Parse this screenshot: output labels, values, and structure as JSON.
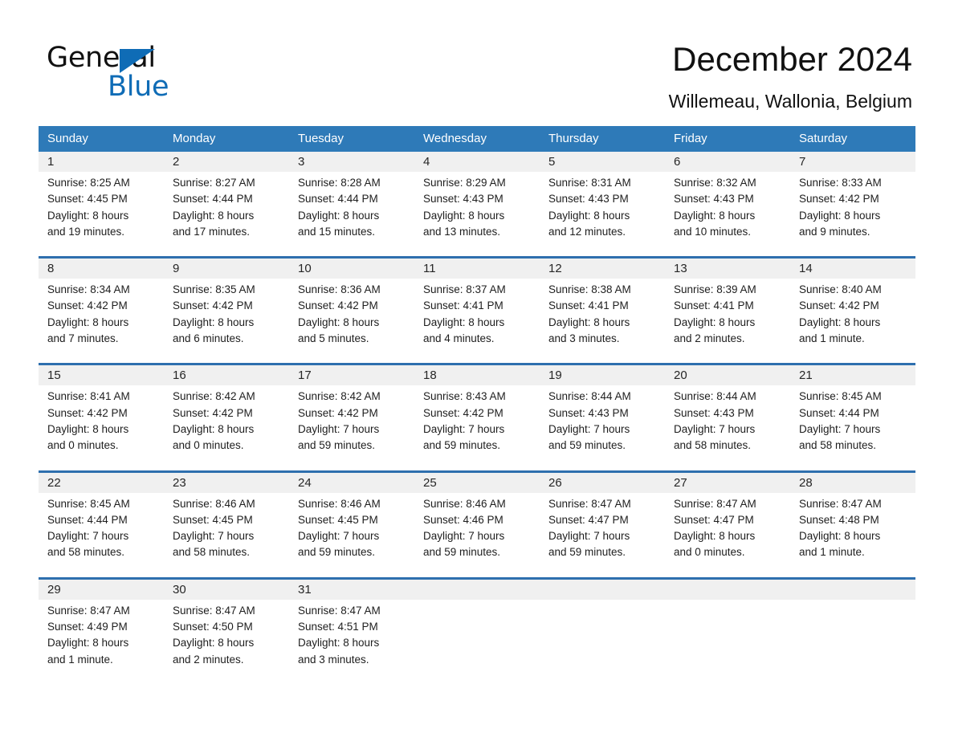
{
  "brand": {
    "name_part1": "General",
    "name_part2": "Blue",
    "triangle_color": "#0f6cb6",
    "accent_color": "#2e7ab8"
  },
  "header": {
    "title": "December 2024",
    "subtitle": "Willemeau, Wallonia, Belgium"
  },
  "calendar": {
    "day_headers": [
      "Sunday",
      "Monday",
      "Tuesday",
      "Wednesday",
      "Thursday",
      "Friday",
      "Saturday"
    ],
    "weeks": [
      {
        "days": [
          {
            "date": "1",
            "sunrise": "Sunrise: 8:25 AM",
            "sunset": "Sunset: 4:45 PM",
            "daylight_line1": "Daylight: 8 hours",
            "daylight_line2": "and 19 minutes."
          },
          {
            "date": "2",
            "sunrise": "Sunrise: 8:27 AM",
            "sunset": "Sunset: 4:44 PM",
            "daylight_line1": "Daylight: 8 hours",
            "daylight_line2": "and 17 minutes."
          },
          {
            "date": "3",
            "sunrise": "Sunrise: 8:28 AM",
            "sunset": "Sunset: 4:44 PM",
            "daylight_line1": "Daylight: 8 hours",
            "daylight_line2": "and 15 minutes."
          },
          {
            "date": "4",
            "sunrise": "Sunrise: 8:29 AM",
            "sunset": "Sunset: 4:43 PM",
            "daylight_line1": "Daylight: 8 hours",
            "daylight_line2": "and 13 minutes."
          },
          {
            "date": "5",
            "sunrise": "Sunrise: 8:31 AM",
            "sunset": "Sunset: 4:43 PM",
            "daylight_line1": "Daylight: 8 hours",
            "daylight_line2": "and 12 minutes."
          },
          {
            "date": "6",
            "sunrise": "Sunrise: 8:32 AM",
            "sunset": "Sunset: 4:43 PM",
            "daylight_line1": "Daylight: 8 hours",
            "daylight_line2": "and 10 minutes."
          },
          {
            "date": "7",
            "sunrise": "Sunrise: 8:33 AM",
            "sunset": "Sunset: 4:42 PM",
            "daylight_line1": "Daylight: 8 hours",
            "daylight_line2": "and 9 minutes."
          }
        ]
      },
      {
        "days": [
          {
            "date": "8",
            "sunrise": "Sunrise: 8:34 AM",
            "sunset": "Sunset: 4:42 PM",
            "daylight_line1": "Daylight: 8 hours",
            "daylight_line2": "and 7 minutes."
          },
          {
            "date": "9",
            "sunrise": "Sunrise: 8:35 AM",
            "sunset": "Sunset: 4:42 PM",
            "daylight_line1": "Daylight: 8 hours",
            "daylight_line2": "and 6 minutes."
          },
          {
            "date": "10",
            "sunrise": "Sunrise: 8:36 AM",
            "sunset": "Sunset: 4:42 PM",
            "daylight_line1": "Daylight: 8 hours",
            "daylight_line2": "and 5 minutes."
          },
          {
            "date": "11",
            "sunrise": "Sunrise: 8:37 AM",
            "sunset": "Sunset: 4:41 PM",
            "daylight_line1": "Daylight: 8 hours",
            "daylight_line2": "and 4 minutes."
          },
          {
            "date": "12",
            "sunrise": "Sunrise: 8:38 AM",
            "sunset": "Sunset: 4:41 PM",
            "daylight_line1": "Daylight: 8 hours",
            "daylight_line2": "and 3 minutes."
          },
          {
            "date": "13",
            "sunrise": "Sunrise: 8:39 AM",
            "sunset": "Sunset: 4:41 PM",
            "daylight_line1": "Daylight: 8 hours",
            "daylight_line2": "and 2 minutes."
          },
          {
            "date": "14",
            "sunrise": "Sunrise: 8:40 AM",
            "sunset": "Sunset: 4:42 PM",
            "daylight_line1": "Daylight: 8 hours",
            "daylight_line2": "and 1 minute."
          }
        ]
      },
      {
        "days": [
          {
            "date": "15",
            "sunrise": "Sunrise: 8:41 AM",
            "sunset": "Sunset: 4:42 PM",
            "daylight_line1": "Daylight: 8 hours",
            "daylight_line2": "and 0 minutes."
          },
          {
            "date": "16",
            "sunrise": "Sunrise: 8:42 AM",
            "sunset": "Sunset: 4:42 PM",
            "daylight_line1": "Daylight: 8 hours",
            "daylight_line2": "and 0 minutes."
          },
          {
            "date": "17",
            "sunrise": "Sunrise: 8:42 AM",
            "sunset": "Sunset: 4:42 PM",
            "daylight_line1": "Daylight: 7 hours",
            "daylight_line2": "and 59 minutes."
          },
          {
            "date": "18",
            "sunrise": "Sunrise: 8:43 AM",
            "sunset": "Sunset: 4:42 PM",
            "daylight_line1": "Daylight: 7 hours",
            "daylight_line2": "and 59 minutes."
          },
          {
            "date": "19",
            "sunrise": "Sunrise: 8:44 AM",
            "sunset": "Sunset: 4:43 PM",
            "daylight_line1": "Daylight: 7 hours",
            "daylight_line2": "and 59 minutes."
          },
          {
            "date": "20",
            "sunrise": "Sunrise: 8:44 AM",
            "sunset": "Sunset: 4:43 PM",
            "daylight_line1": "Daylight: 7 hours",
            "daylight_line2": "and 58 minutes."
          },
          {
            "date": "21",
            "sunrise": "Sunrise: 8:45 AM",
            "sunset": "Sunset: 4:44 PM",
            "daylight_line1": "Daylight: 7 hours",
            "daylight_line2": "and 58 minutes."
          }
        ]
      },
      {
        "days": [
          {
            "date": "22",
            "sunrise": "Sunrise: 8:45 AM",
            "sunset": "Sunset: 4:44 PM",
            "daylight_line1": "Daylight: 7 hours",
            "daylight_line2": "and 58 minutes."
          },
          {
            "date": "23",
            "sunrise": "Sunrise: 8:46 AM",
            "sunset": "Sunset: 4:45 PM",
            "daylight_line1": "Daylight: 7 hours",
            "daylight_line2": "and 58 minutes."
          },
          {
            "date": "24",
            "sunrise": "Sunrise: 8:46 AM",
            "sunset": "Sunset: 4:45 PM",
            "daylight_line1": "Daylight: 7 hours",
            "daylight_line2": "and 59 minutes."
          },
          {
            "date": "25",
            "sunrise": "Sunrise: 8:46 AM",
            "sunset": "Sunset: 4:46 PM",
            "daylight_line1": "Daylight: 7 hours",
            "daylight_line2": "and 59 minutes."
          },
          {
            "date": "26",
            "sunrise": "Sunrise: 8:47 AM",
            "sunset": "Sunset: 4:47 PM",
            "daylight_line1": "Daylight: 7 hours",
            "daylight_line2": "and 59 minutes."
          },
          {
            "date": "27",
            "sunrise": "Sunrise: 8:47 AM",
            "sunset": "Sunset: 4:47 PM",
            "daylight_line1": "Daylight: 8 hours",
            "daylight_line2": "and 0 minutes."
          },
          {
            "date": "28",
            "sunrise": "Sunrise: 8:47 AM",
            "sunset": "Sunset: 4:48 PM",
            "daylight_line1": "Daylight: 8 hours",
            "daylight_line2": "and 1 minute."
          }
        ]
      },
      {
        "days": [
          {
            "date": "29",
            "sunrise": "Sunrise: 8:47 AM",
            "sunset": "Sunset: 4:49 PM",
            "daylight_line1": "Daylight: 8 hours",
            "daylight_line2": "and 1 minute."
          },
          {
            "date": "30",
            "sunrise": "Sunrise: 8:47 AM",
            "sunset": "Sunset: 4:50 PM",
            "daylight_line1": "Daylight: 8 hours",
            "daylight_line2": "and 2 minutes."
          },
          {
            "date": "31",
            "sunrise": "Sunrise: 8:47 AM",
            "sunset": "Sunset: 4:51 PM",
            "daylight_line1": "Daylight: 8 hours",
            "daylight_line2": "and 3 minutes."
          },
          {
            "date": "",
            "sunrise": "",
            "sunset": "",
            "daylight_line1": "",
            "daylight_line2": ""
          },
          {
            "date": "",
            "sunrise": "",
            "sunset": "",
            "daylight_line1": "",
            "daylight_line2": ""
          },
          {
            "date": "",
            "sunrise": "",
            "sunset": "",
            "daylight_line1": "",
            "daylight_line2": ""
          },
          {
            "date": "",
            "sunrise": "",
            "sunset": "",
            "daylight_line1": "",
            "daylight_line2": ""
          }
        ]
      }
    ]
  }
}
